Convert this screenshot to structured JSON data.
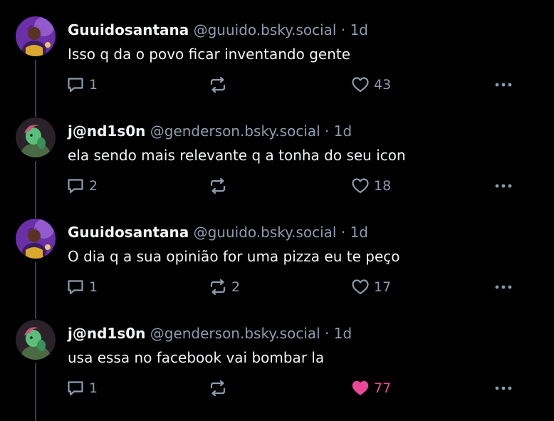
{
  "colors": {
    "background": "#000000",
    "text": "#f1f3f5",
    "muted": "#8d9cae",
    "thread_line": "#2e4052",
    "like_active": "#ec4899"
  },
  "posts": [
    {
      "display_name": "Guuidosantana",
      "handle": "@guuido.bsky.social",
      "separator": "·",
      "time": "1d",
      "text": "Isso q da o povo ficar inventando gente",
      "reply_count": "1",
      "repost_count": "",
      "like_count": "43",
      "liked": false,
      "avatar_icon": "avatar-purple-portrait"
    },
    {
      "display_name": "j@nd1s0n",
      "handle": "@genderson.bsky.social",
      "separator": "·",
      "time": "1d",
      "text": "ela sendo mais relevante q a tonha do seu icon",
      "reply_count": "2",
      "repost_count": "",
      "like_count": "18",
      "liked": false,
      "avatar_icon": "avatar-green-figure"
    },
    {
      "display_name": "Guuidosantana",
      "handle": "@guuido.bsky.social",
      "separator": "·",
      "time": "1d",
      "text": "O dia q a sua opinião for uma pizza eu te peço",
      "reply_count": "1",
      "repost_count": "2",
      "like_count": "17",
      "liked": false,
      "avatar_icon": "avatar-purple-portrait"
    },
    {
      "display_name": "j@nd1s0n",
      "handle": "@genderson.bsky.social",
      "separator": "·",
      "time": "1d",
      "text": "usa essa no facebook vai bombar la",
      "reply_count": "1",
      "repost_count": "",
      "like_count": "77",
      "liked": true,
      "avatar_icon": "avatar-green-figure"
    }
  ]
}
